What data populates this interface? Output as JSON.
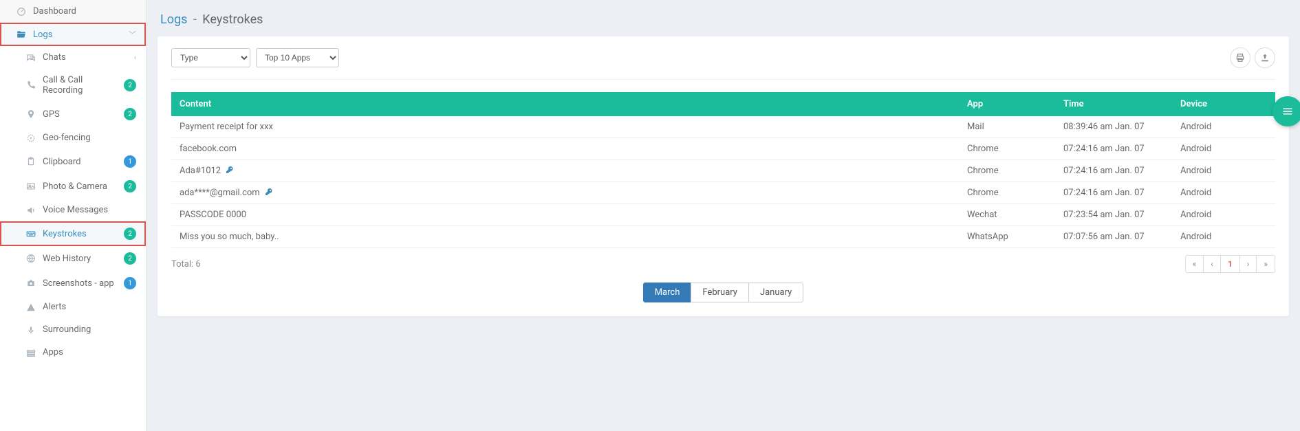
{
  "breadcrumb": {
    "parent": "Logs",
    "current": "Keystrokes"
  },
  "sidebar": {
    "dashboard": "Dashboard",
    "logs": "Logs",
    "items": [
      {
        "label": "Chats",
        "badge": null,
        "chevron": true
      },
      {
        "label": "Call & Call Recording",
        "badge": "2",
        "badgeColor": "teal"
      },
      {
        "label": "GPS",
        "badge": "2",
        "badgeColor": "teal"
      },
      {
        "label": "Geo-fencing",
        "badge": null
      },
      {
        "label": "Clipboard",
        "badge": "1",
        "badgeColor": "blue"
      },
      {
        "label": "Photo & Camera",
        "badge": "2",
        "badgeColor": "teal"
      },
      {
        "label": "Voice Messages",
        "badge": null
      },
      {
        "label": "Keystrokes",
        "badge": "2",
        "badgeColor": "teal",
        "active": true
      },
      {
        "label": "Web History",
        "badge": "2",
        "badgeColor": "teal"
      },
      {
        "label": "Screenshots - app",
        "badge": "1",
        "badgeColor": "blue"
      },
      {
        "label": "Alerts",
        "badge": null
      },
      {
        "label": "Surrounding",
        "badge": null
      },
      {
        "label": "Apps",
        "badge": null
      }
    ]
  },
  "filters": {
    "type_label": "Type",
    "top_apps_label": "Top 10 Apps"
  },
  "table": {
    "headers": {
      "content": "Content",
      "app": "App",
      "time": "Time",
      "device": "Device"
    },
    "rows": [
      {
        "content": "Payment receipt for xxx",
        "hasKey": false,
        "app": "Mail",
        "time": "08:39:46 am Jan. 07",
        "device": "Android"
      },
      {
        "content": "facebook.com",
        "hasKey": false,
        "app": "Chrome",
        "time": "07:24:16 am Jan. 07",
        "device": "Android"
      },
      {
        "content": "Ada#1012",
        "hasKey": true,
        "app": "Chrome",
        "time": "07:24:16 am Jan. 07",
        "device": "Android"
      },
      {
        "content": "ada****@gmail.com",
        "hasKey": true,
        "app": "Chrome",
        "time": "07:24:16 am Jan. 07",
        "device": "Android"
      },
      {
        "content": "PASSCODE 0000",
        "hasKey": false,
        "app": "Wechat",
        "time": "07:23:54 am Jan. 07",
        "device": "Android"
      },
      {
        "content": "Miss you so much, baby..",
        "hasKey": false,
        "app": "WhatsApp",
        "time": "07:07:56 am Jan. 07",
        "device": "Android"
      }
    ],
    "total_label": "Total: 6"
  },
  "pagination": {
    "current": "1"
  },
  "months": [
    {
      "label": "March",
      "active": true
    },
    {
      "label": "February",
      "active": false
    },
    {
      "label": "January",
      "active": false
    }
  ]
}
